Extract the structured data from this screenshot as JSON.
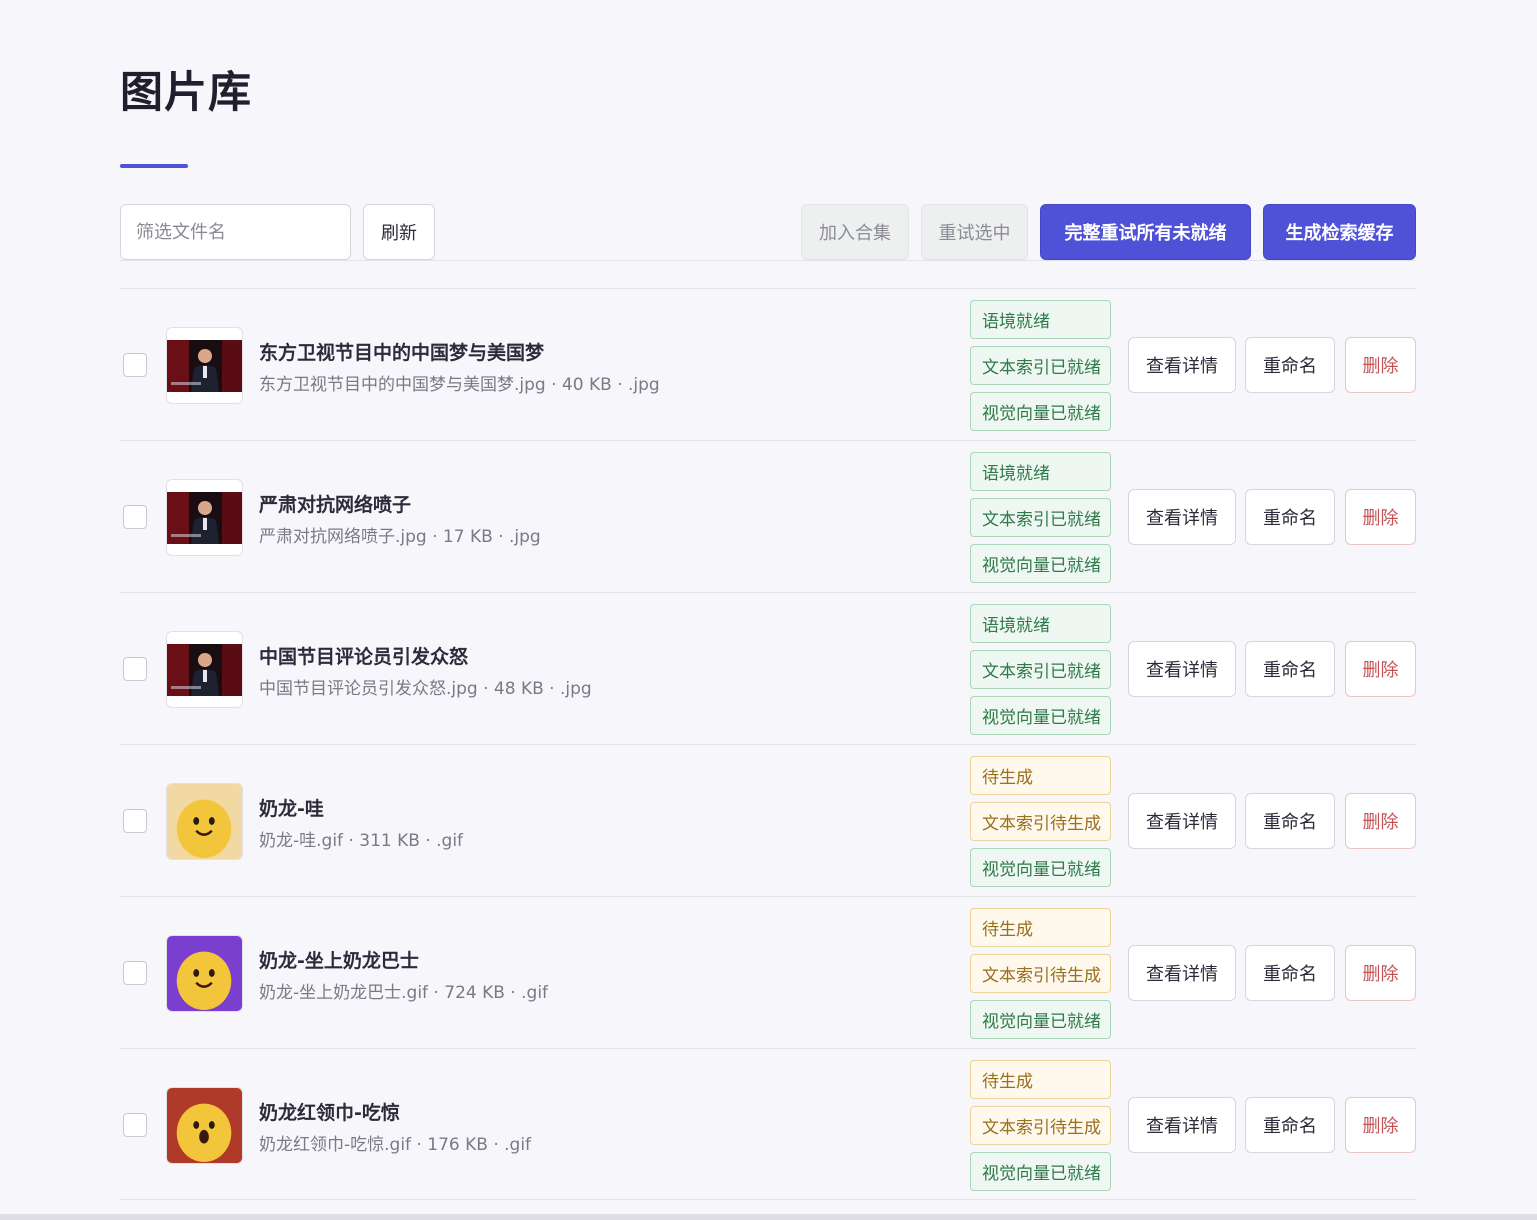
{
  "page": {
    "title": "图片库"
  },
  "toolbar": {
    "filter_placeholder": "筛选文件名",
    "filter_value": "",
    "refresh_label": "刷新",
    "add_to_collection_label": "加入合集",
    "retry_selected_label": "重试选中",
    "retry_all_label": "完整重试所有未就绪",
    "build_cache_label": "生成检索缓存"
  },
  "actions": {
    "view_label": "查看详情",
    "rename_label": "重命名",
    "delete_label": "删除"
  },
  "colors": {
    "accent": "#4f52d6",
    "ready": "#2f7a4b",
    "pending": "#9a6f1e",
    "danger": "#c45454"
  },
  "items": [
    {
      "name": "东方卫视节目中的中国梦与美国梦",
      "meta": "东方卫视节目中的中国梦与美国梦.jpg · 40 KB · .jpg",
      "thumb": "tv-studio",
      "badges": [
        {
          "label": "语境就绪",
          "status": "ok"
        },
        {
          "label": "文本索引已就绪",
          "status": "ok"
        },
        {
          "label": "视觉向量已就绪",
          "status": "ok"
        }
      ]
    },
    {
      "name": "严肃对抗网络喷子",
      "meta": "严肃对抗网络喷子.jpg · 17 KB · .jpg",
      "thumb": "tv-studio",
      "badges": [
        {
          "label": "语境就绪",
          "status": "ok"
        },
        {
          "label": "文本索引已就绪",
          "status": "ok"
        },
        {
          "label": "视觉向量已就绪",
          "status": "ok"
        }
      ]
    },
    {
      "name": "中国节目评论员引发众怒",
      "meta": "中国节目评论员引发众怒.jpg · 48 KB · .jpg",
      "thumb": "tv-studio",
      "badges": [
        {
          "label": "语境就绪",
          "status": "ok"
        },
        {
          "label": "文本索引已就绪",
          "status": "ok"
        },
        {
          "label": "视觉向量已就绪",
          "status": "ok"
        }
      ]
    },
    {
      "name": "奶龙-哇",
      "meta": "奶龙-哇.gif · 311 KB · .gif",
      "thumb": "yellow-character",
      "badges": [
        {
          "label": "待生成",
          "status": "pending"
        },
        {
          "label": "文本索引待生成",
          "status": "pending"
        },
        {
          "label": "视觉向量已就绪",
          "status": "ok"
        }
      ]
    },
    {
      "name": "奶龙-坐上奶龙巴士",
      "meta": "奶龙-坐上奶龙巴士.gif · 724 KB · .gif",
      "thumb": "yellow-character-purple",
      "badges": [
        {
          "label": "待生成",
          "status": "pending"
        },
        {
          "label": "文本索引待生成",
          "status": "pending"
        },
        {
          "label": "视觉向量已就绪",
          "status": "ok"
        }
      ]
    },
    {
      "name": "奶龙红领巾-吃惊",
      "meta": "奶龙红领巾-吃惊.gif · 176 KB · .gif",
      "thumb": "yellow-character-red",
      "badges": [
        {
          "label": "待生成",
          "status": "pending"
        },
        {
          "label": "文本索引待生成",
          "status": "pending"
        },
        {
          "label": "视觉向量已就绪",
          "status": "ok"
        }
      ]
    }
  ]
}
